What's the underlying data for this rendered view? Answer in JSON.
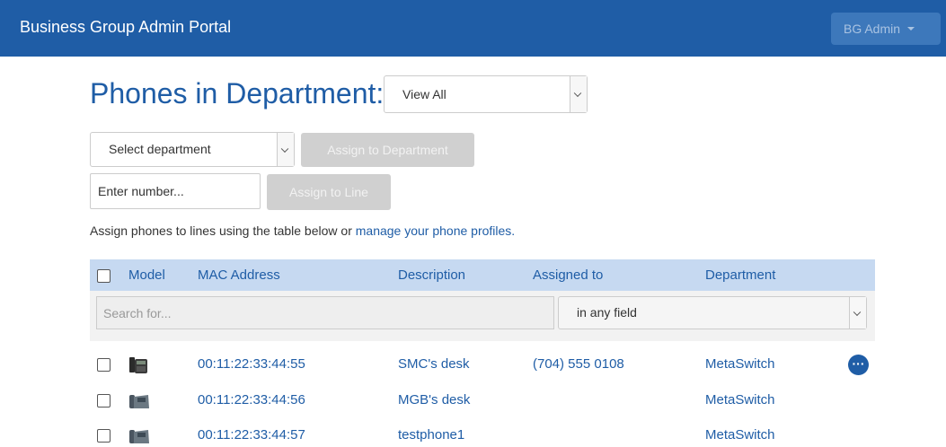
{
  "header": {
    "brand": "Business Group Admin Portal",
    "user_menu_label": "BG Admin"
  },
  "page": {
    "title": "Phones in Department:",
    "view_filter": "View All"
  },
  "assign_department": {
    "select_placeholder": "Select department",
    "button_label": "Assign to Department"
  },
  "assign_line": {
    "input_placeholder": "Enter number...",
    "button_label": "Assign to Line"
  },
  "helper": {
    "text": "Assign phones to lines using the table below or ",
    "link_text": "manage your phone profiles."
  },
  "table": {
    "columns": {
      "model": "Model",
      "mac": "MAC Address",
      "description": "Description",
      "assigned": "Assigned to",
      "department": "Department"
    },
    "search_placeholder": "Search for...",
    "search_scope": "in any field",
    "rows": [
      {
        "model_icon": "desk-phone-dark-icon",
        "mac": "00:11:22:33:44:55",
        "description": "SMC's desk",
        "assigned": "(704) 555 0108",
        "department": "MetaSwitch",
        "has_actions": true
      },
      {
        "model_icon": "desk-phone-icon",
        "mac": "00:11:22:33:44:56",
        "description": "MGB's desk",
        "assigned": "",
        "department": "MetaSwitch",
        "has_actions": false
      },
      {
        "model_icon": "desk-phone-icon",
        "mac": "00:11:22:33:44:57",
        "description": "testphone1",
        "assigned": "",
        "department": "MetaSwitch",
        "has_actions": false
      }
    ]
  },
  "colors": {
    "header_bg": "#1f5da6",
    "link": "#1f5da6",
    "table_header_bg": "#c6d9f1",
    "disabled_button": "#d0d0d0"
  }
}
